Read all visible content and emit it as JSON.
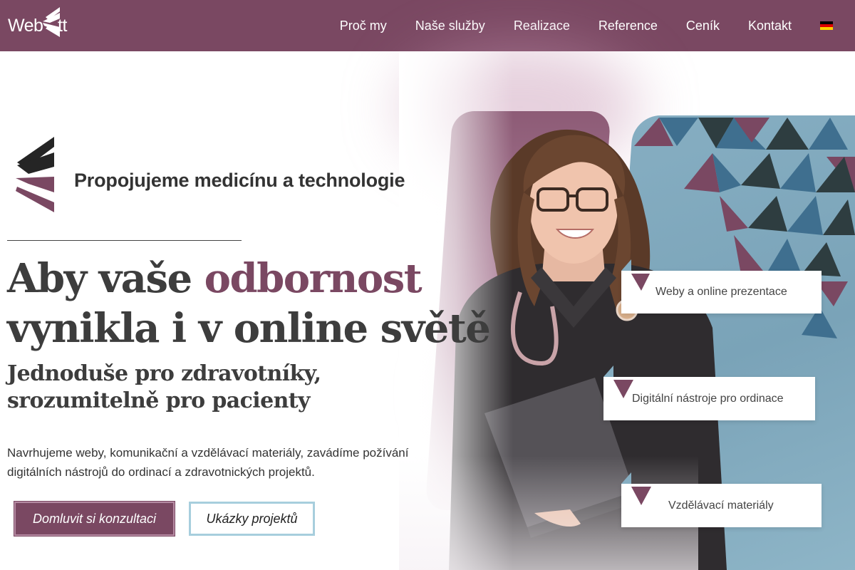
{
  "header": {
    "logo_left": "Web",
    "logo_right": "tt",
    "nav": [
      "Proč my",
      "Naše služby",
      "Realizace",
      "Reference",
      "Ceník",
      "Kontakt"
    ],
    "language_flag": "de-flag"
  },
  "hero": {
    "tagline": "Propojujeme medicínu a technologie",
    "headline_part1": "Aby vaše ",
    "headline_accent": "odbornost",
    "headline_line2": "vynikla i v online světě",
    "subhead_line1": "Jednoduše pro zdravotníky,",
    "subhead_line2": "srozumitelně pro pacienty",
    "description_line1": "Navrhujeme weby, komunikační a vzdělávací materiály, zavádíme požívání",
    "description_line2": "digitálních nástrojů do ordinací a zdravotnických projektů.",
    "primary_button": "Domluvit si konzultaci",
    "secondary_button": "Ukázky projektů"
  },
  "services": [
    "Weby a online prezentace",
    "Digitální nástroje pro ordinace",
    "Vzdělávací materiály"
  ],
  "colors": {
    "brand_purple": "#7a4862",
    "brand_blue": "#86aec2",
    "dark": "#2b2b2b"
  }
}
